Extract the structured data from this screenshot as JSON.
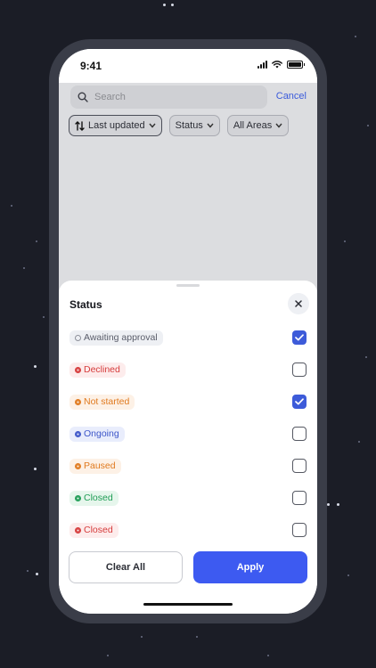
{
  "status_bar": {
    "time": "9:41"
  },
  "search": {
    "placeholder": "Search",
    "cancel_label": "Cancel"
  },
  "filters": [
    {
      "label": "Last updated",
      "icon": "sort-icon",
      "active": true
    },
    {
      "label": "Status",
      "icon": "chevron-down-icon"
    },
    {
      "label": "All Areas",
      "icon": "chevron-down-icon"
    }
  ],
  "sheet": {
    "title": "Status",
    "options": [
      {
        "label": "Awaiting approval",
        "checked": true,
        "text_color": "#5a5d6a",
        "bg": "#eef0f4",
        "dot": "#8c8f99"
      },
      {
        "label": "Declined",
        "checked": false,
        "text_color": "#d63b3b",
        "bg": "#fdecec",
        "dot": "#d63b3b"
      },
      {
        "label": "Not started",
        "checked": true,
        "text_color": "#e07a1f",
        "bg": "#fdf1e6",
        "dot": "#e07a1f"
      },
      {
        "label": "Ongoing",
        "checked": false,
        "text_color": "#3d56c9",
        "bg": "#e9edfc",
        "dot": "#3d56c9"
      },
      {
        "label": "Paused",
        "checked": false,
        "text_color": "#e07a1f",
        "bg": "#fdf1e6",
        "dot": "#e07a1f"
      },
      {
        "label": "Closed",
        "checked": false,
        "text_color": "#1f9d55",
        "bg": "#e6f6ec",
        "dot": "#1f9d55"
      },
      {
        "label": "Closed",
        "checked": false,
        "text_color": "#d63b3b",
        "bg": "#fdecec",
        "dot": "#d63b3b"
      }
    ],
    "clear_label": "Clear All",
    "apply_label": "Apply"
  },
  "colors": {
    "accent": "#3d5af1",
    "background": "#1b1d26"
  }
}
